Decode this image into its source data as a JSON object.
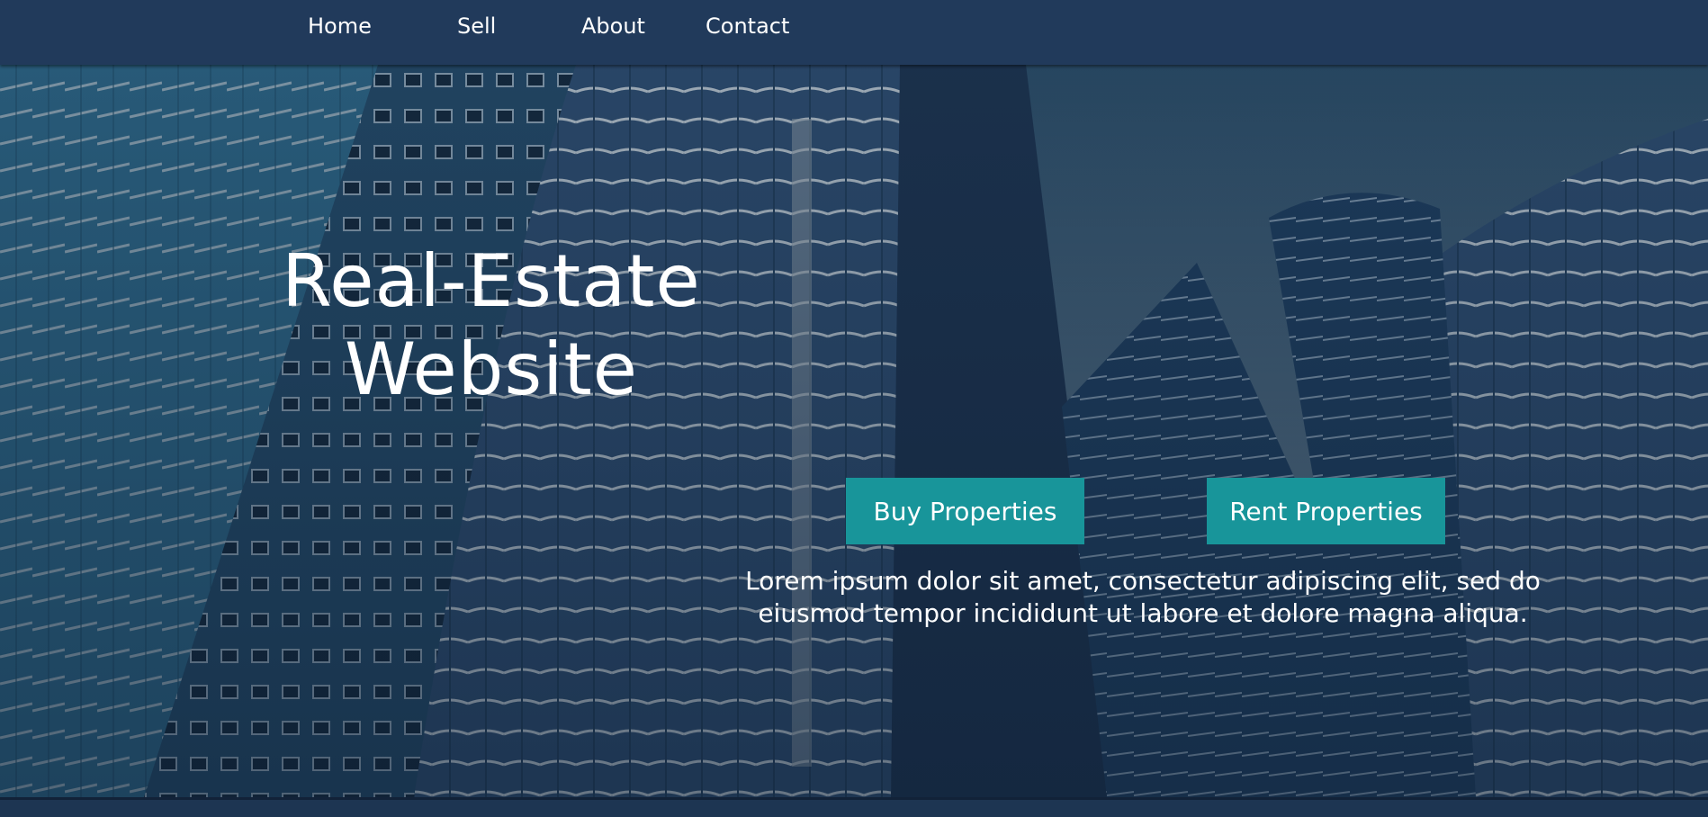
{
  "nav": {
    "items": [
      {
        "label": "Home"
      },
      {
        "label": "Sell"
      },
      {
        "label": "About"
      },
      {
        "label": "Contact"
      }
    ]
  },
  "hero": {
    "title": "Real-Estate Website",
    "buy_button": "Buy Properties",
    "rent_button": "Rent Properties",
    "description": "Lorem ipsum dolor sit amet, consectetur adipiscing elit, sed do eiusmod tempor incididunt ut labore et dolore magna aliqua."
  },
  "colors": {
    "navbar": "#213a5b",
    "button": "#18959a",
    "text": "#ffffff"
  }
}
